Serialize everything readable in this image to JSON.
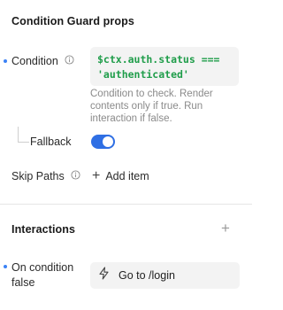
{
  "props_section": {
    "title": "Condition Guard props",
    "condition": {
      "label": "Condition",
      "code": "$ctx.auth.status === 'authenticated'",
      "help": "Condition to check. Render contents only if true. Run interaction if false."
    },
    "fallback": {
      "label": "Fallback",
      "enabled": true
    },
    "skip_paths": {
      "label": "Skip Paths",
      "add_label": "Add item"
    }
  },
  "interactions_section": {
    "title": "Interactions",
    "on_condition_false": {
      "label": "On condition false",
      "action_label": "Go to /login"
    }
  },
  "colors": {
    "accent": "#2f6fe4",
    "dot": "#3b82f6",
    "code": "#1f9d4a",
    "help_text": "#8a8a8a"
  }
}
